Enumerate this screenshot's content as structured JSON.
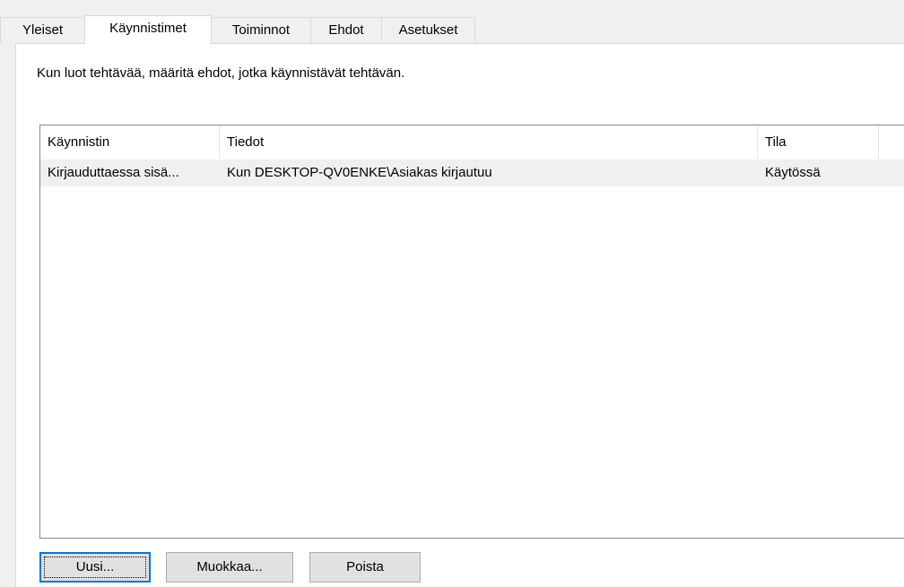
{
  "tabs": [
    {
      "label": "Yleiset"
    },
    {
      "label": "Käynnistimet",
      "active": true
    },
    {
      "label": "Toiminnot"
    },
    {
      "label": "Ehdot"
    },
    {
      "label": "Asetukset"
    }
  ],
  "description": "Kun luot tehtävää, määritä ehdot, jotka käynnistävät tehtävän.",
  "list": {
    "columns": [
      "Käynnistin",
      "Tiedot",
      "Tila"
    ],
    "rows": [
      {
        "trigger": "Kirjauduttaessa sisä...",
        "details": "Kun DESKTOP-QV0ENKE\\Asiakas kirjautuu",
        "status": "Käytössä",
        "selected": true
      }
    ]
  },
  "buttons": {
    "new_label": "Uusi...",
    "edit_label": "Muokkaa...",
    "delete_label": "Poista"
  },
  "colors": {
    "window_bg": "#f0f0f0",
    "panel_bg": "#ffffff",
    "selection_bg": "#f0f0f0",
    "default_button_border": "#0078d7"
  }
}
